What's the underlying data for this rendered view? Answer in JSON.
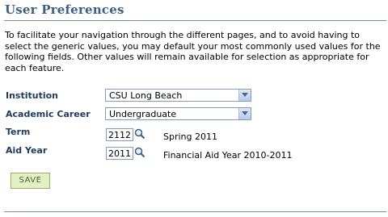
{
  "page": {
    "title": "User Preferences",
    "intro": "To facilitate your navigation through the different pages, and to avoid having to select the generic values, you may default your most commonly used values for the following fields. Other values will remain available for selection as appropriate for each feature."
  },
  "form": {
    "institution": {
      "label": "Institution",
      "value": "CSU Long Beach"
    },
    "academic_career": {
      "label": "Academic Career",
      "value": "Undergraduate"
    },
    "term": {
      "label": "Term",
      "value": "2112",
      "description": "Spring 2011"
    },
    "aid_year": {
      "label": "Aid Year",
      "value": "2011",
      "description": "Financial Aid Year 2010-2011"
    }
  },
  "actions": {
    "save_label": "SAVE"
  },
  "icons": {
    "lookup": "magnifier-icon",
    "dropdown": "chevron-down-icon"
  },
  "colors": {
    "title": "#3d5f82",
    "label": "#203c5a",
    "save_bg": "#e4efc8",
    "save_border": "#96b35a"
  }
}
